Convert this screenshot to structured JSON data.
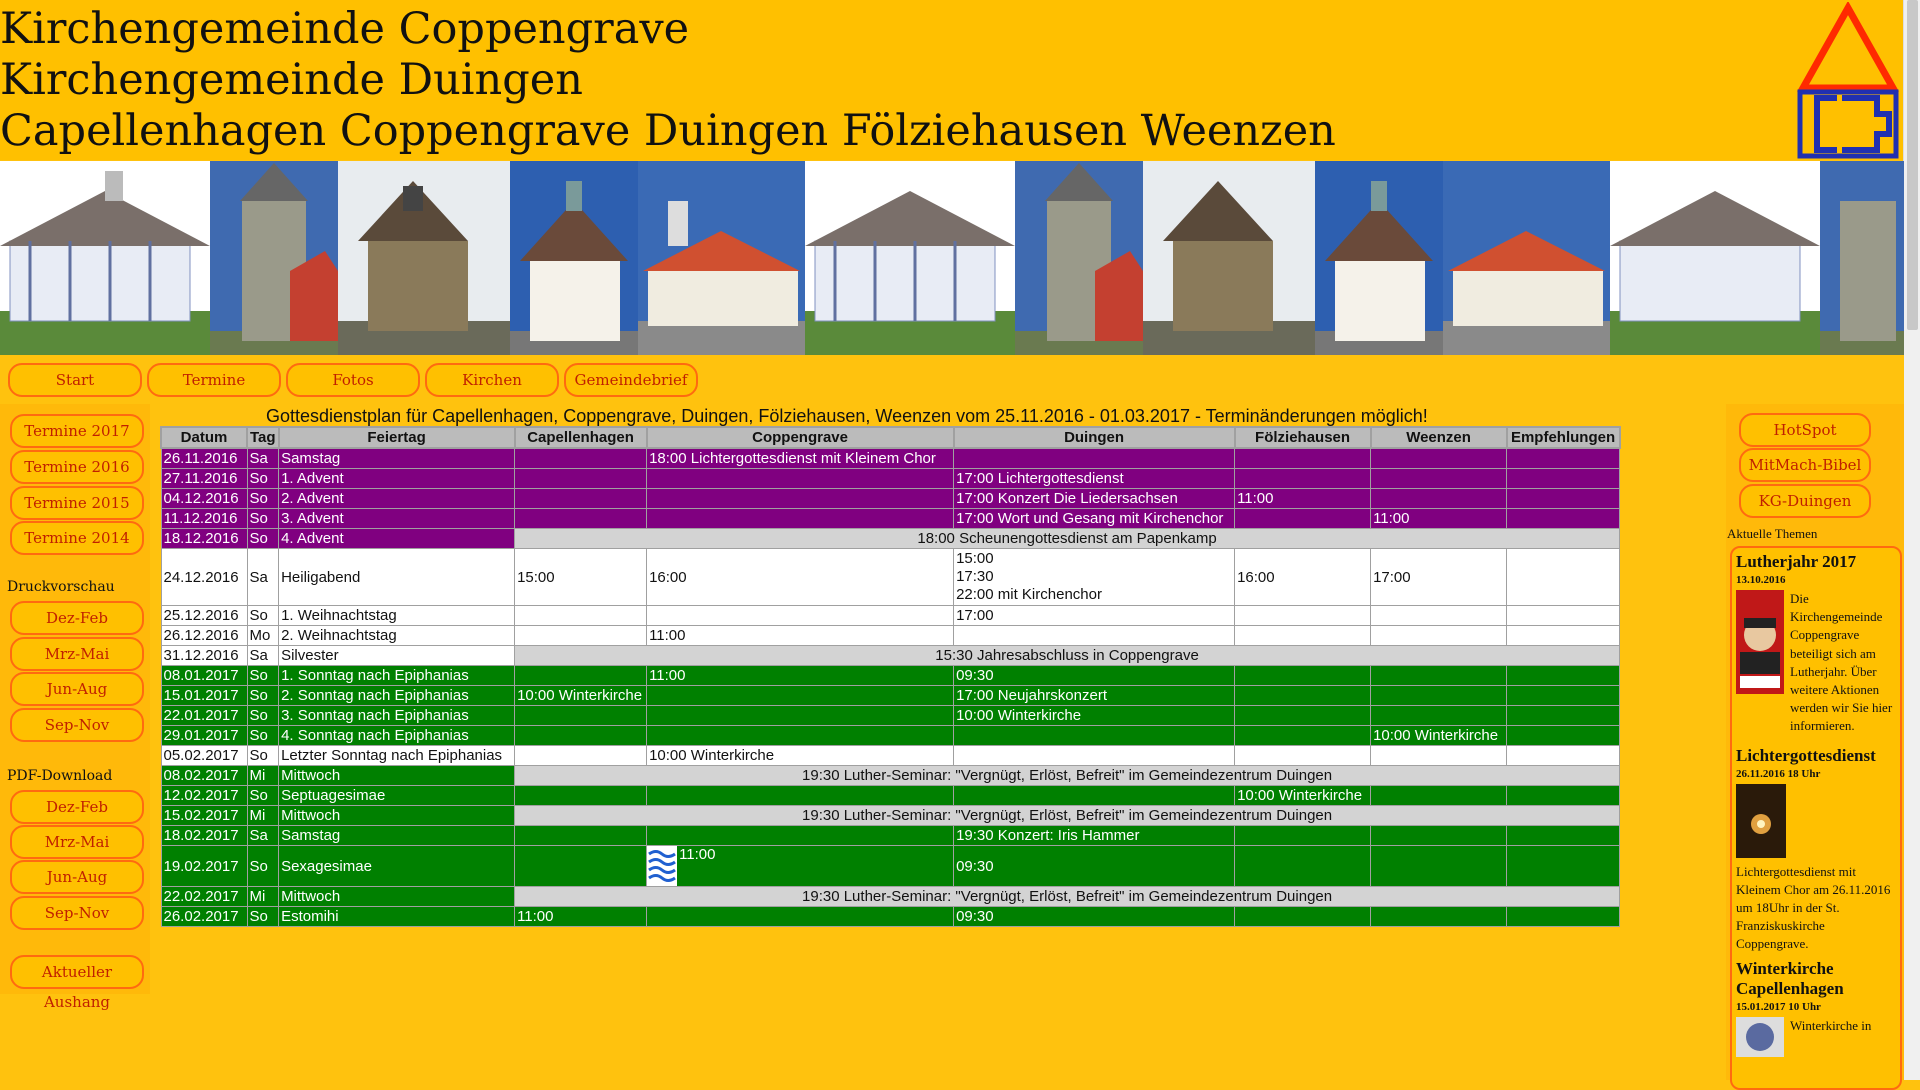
{
  "header": {
    "lines": [
      "Kirchengemeinde Coppengrave",
      "Kirchengemeinde Duingen",
      "Capellenhagen Coppengrave Duingen Fölziehausen Weenzen"
    ]
  },
  "nav": [
    "Start",
    "Termine",
    "Fotos",
    "Kirchen",
    "Gemeindebrief"
  ],
  "left": {
    "termine": [
      "Termine 2017",
      "Termine 2016",
      "Termine 2015",
      "Termine 2014"
    ],
    "druck_head": "Druckvorschau",
    "druck": [
      "Dez-Feb",
      "Mrz-Mai",
      "Jun-Aug",
      "Sep-Nov"
    ],
    "pdf_head": "PDF-Download",
    "pdf": [
      "Dez-Feb",
      "Mrz-Mai",
      "Jun-Aug",
      "Sep-Nov"
    ],
    "aushang": "Aktueller Aushang"
  },
  "right": {
    "buttons": [
      "HotSpot",
      "MitMach-Bibel",
      "KG-Duingen"
    ],
    "topics_head": "Aktuelle Themen",
    "news": [
      {
        "title": "Lutherjahr 2017",
        "date": "13.10.2016",
        "text": "Die Kirchengemeinde Coppengrave beteiligt sich am Lutherjahr. Über weitere Aktionen werden wir Sie hier informieren."
      },
      {
        "title": "Lichtergottesdienst",
        "date": "26.11.2016 18 Uhr",
        "text": "Lichtergottesdienst mit Kleinem Chor am 26.11.2016 um 18Uhr in der St. Franziskuskirche Coppengrave."
      },
      {
        "title": "Winterkirche Capellenhagen",
        "date": "15.01.2017 10 Uhr",
        "text": "Winterkirche in"
      }
    ]
  },
  "plan": {
    "title": "Gottesdienstplan für Capellenhagen, Coppengrave, Duingen, Fölziehausen, Weenzen vom 25.11.2016 - 01.03.2017 - Terminänderungen möglich!",
    "headers": [
      "Datum",
      "Tag",
      "Feiertag",
      "Capellenhagen",
      "Coppengrave",
      "Duingen",
      "Fölziehausen",
      "Weenzen",
      "Empfehlungen"
    ],
    "rows": [
      {
        "style": "purple",
        "cells": [
          "26.11.2016",
          "Sa",
          "Samstag",
          "",
          "18:00 Lichtergottesdienst mit Kleinem Chor",
          "",
          "",
          "",
          ""
        ]
      },
      {
        "style": "purple",
        "cells": [
          "27.11.2016",
          "So",
          "1. Advent",
          "",
          "",
          "17:00 Lichtergottesdienst",
          "",
          "",
          ""
        ]
      },
      {
        "style": "purple",
        "cells": [
          "04.12.2016",
          "So",
          "2. Advent",
          "",
          "",
          "17:00 Konzert Die Liedersachsen",
          "11:00",
          "",
          ""
        ]
      },
      {
        "style": "purple",
        "cells": [
          "11.12.2016",
          "So",
          "3. Advent",
          "",
          "",
          "17:00 Wort und Gesang mit Kirchenchor",
          "",
          "11:00",
          ""
        ]
      },
      {
        "style": "purple",
        "span": "18:00 Scheunengottesdienst am Papenkamp",
        "cells": [
          "18.12.2016",
          "So",
          "4. Advent"
        ]
      },
      {
        "style": "white",
        "cells": [
          "24.12.2016",
          "Sa",
          "Heiligabend",
          "15:00",
          "16:00",
          "15:00\n17:30\n22:00 mit Kirchenchor",
          "16:00",
          "17:00",
          ""
        ]
      },
      {
        "style": "white",
        "cells": [
          "25.12.2016",
          "So",
          "1. Weihnachtstag",
          "",
          "",
          "17:00",
          "",
          "",
          ""
        ]
      },
      {
        "style": "white",
        "cells": [
          "26.12.2016",
          "Mo",
          "2. Weihnachtstag",
          "",
          "11:00",
          "",
          "",
          "",
          ""
        ]
      },
      {
        "style": "white",
        "span": "15:30 Jahresabschluss in Coppengrave",
        "cells": [
          "31.12.2016",
          "Sa",
          "Silvester"
        ]
      },
      {
        "style": "green",
        "cells": [
          "08.01.2017",
          "So",
          "1. Sonntag nach Epiphanias",
          "",
          "11:00",
          "09:30",
          "",
          "",
          ""
        ]
      },
      {
        "style": "green",
        "cells": [
          "15.01.2017",
          "So",
          "2. Sonntag nach Epiphanias",
          "10:00 Winterkirche",
          "",
          "17:00 Neujahrskonzert",
          "",
          "",
          ""
        ]
      },
      {
        "style": "green",
        "cells": [
          "22.01.2017",
          "So",
          "3. Sonntag nach Epiphanias",
          "",
          "",
          "10:00 Winterkirche",
          "",
          "",
          ""
        ]
      },
      {
        "style": "green",
        "cells": [
          "29.01.2017",
          "So",
          "4. Sonntag nach Epiphanias",
          "",
          "",
          "",
          "",
          "10:00 Winterkirche",
          ""
        ]
      },
      {
        "style": "white",
        "cells": [
          "05.02.2017",
          "So",
          "Letzter Sonntag nach Epiphanias",
          "",
          "10:00 Winterkirche",
          "",
          "",
          "",
          ""
        ]
      },
      {
        "style": "green",
        "span": "19:30 Luther-Seminar: \"Vergnügt, Erlöst, Befreit\" im Gemeindezentrum Duingen",
        "cells": [
          "08.02.2017",
          "Mi",
          "Mittwoch"
        ]
      },
      {
        "style": "green",
        "cells": [
          "12.02.2017",
          "So",
          "Septuagesimae",
          "",
          "",
          "",
          "10:00 Winterkirche",
          "",
          ""
        ]
      },
      {
        "style": "green",
        "span": "19:30 Luther-Seminar: \"Vergnügt, Erlöst, Befreit\" im Gemeindezentrum Duingen",
        "cells": [
          "15.02.2017",
          "Mi",
          "Mittwoch"
        ]
      },
      {
        "style": "green",
        "cells": [
          "18.02.2017",
          "Sa",
          "Samstag",
          "",
          "",
          "19:30 Konzert: Iris Hammer",
          "",
          "",
          ""
        ]
      },
      {
        "style": "green",
        "tall": true,
        "cells": [
          "19.02.2017",
          "So",
          "Sexagesimae",
          "",
          "11:00",
          "09:30",
          "",
          "",
          ""
        ]
      },
      {
        "style": "green",
        "span": "19:30 Luther-Seminar: \"Vergnügt, Erlöst, Befreit\" im Gemeindezentrum Duingen",
        "cells": [
          "22.02.2017",
          "Mi",
          "Mittwoch"
        ]
      },
      {
        "style": "green",
        "cells": [
          "26.02.2017",
          "So",
          "Estomihi",
          "11:00",
          "",
          "09:30",
          "",
          "",
          ""
        ]
      }
    ]
  },
  "colors": {
    "purple": "#800080",
    "green": "#008000",
    "gold": "#ffc000",
    "button_border": "#ff6a10",
    "button_text": "#c02000"
  }
}
